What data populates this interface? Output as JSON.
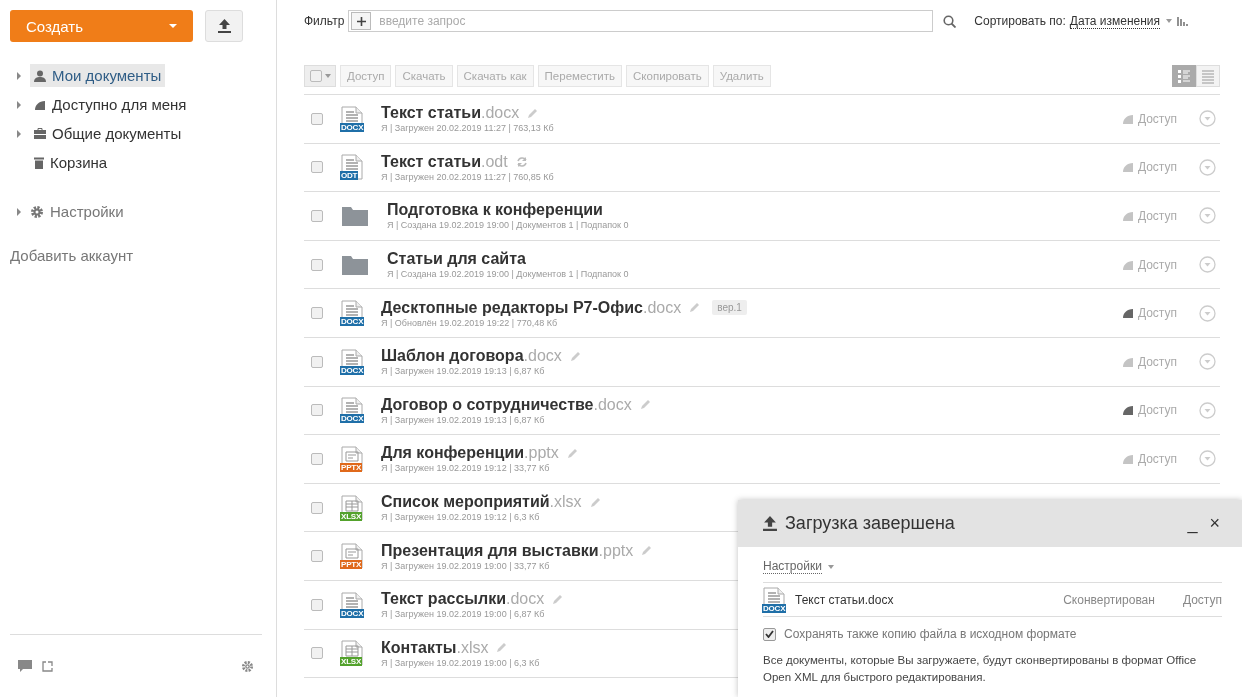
{
  "sidebar": {
    "create_button": "Создать",
    "tree": [
      {
        "label": "Мои документы",
        "kind": "person",
        "expandable": true,
        "selected": true
      },
      {
        "label": "Доступно для меня",
        "kind": "share",
        "expandable": true,
        "selected": false
      },
      {
        "label": "Общие документы",
        "kind": "briefcase",
        "expandable": true,
        "selected": false
      },
      {
        "label": "Корзина",
        "kind": "trash",
        "expandable": false,
        "selected": false
      }
    ],
    "settings": "Настройки",
    "add_account": "Добавить аккаунт"
  },
  "filter": {
    "label": "Фильтр",
    "placeholder": "введите запрос"
  },
  "sort": {
    "label": "Сортировать по:",
    "value": "Дата изменения"
  },
  "toolbar": {
    "select_all": {
      "checked": false
    },
    "buttons": [
      "Доступ",
      "Скачать",
      "Скачать как",
      "Переместить",
      "Скопировать",
      "Удалить"
    ],
    "views": [
      {
        "kind": "detailed",
        "selected": true
      },
      {
        "kind": "compact",
        "selected": false
      }
    ]
  },
  "files": [
    {
      "kind": "docx",
      "badge": "DOCX",
      "name": "Текст статьи",
      "ext": ".docx",
      "checked": false,
      "editable": true,
      "converting": false,
      "meta": "Я | Загружен 20.02.2019 11:27 | 763,13 Кб",
      "share": {
        "label": "Доступ",
        "shared": false
      }
    },
    {
      "kind": "odt",
      "badge": "ODT",
      "name": "Текст статьи",
      "ext": ".odt",
      "checked": false,
      "editable": false,
      "converting": true,
      "meta": "Я | Загружен 20.02.2019 11:27 | 760,85 Кб",
      "share": {
        "label": "Доступ",
        "shared": false
      }
    },
    {
      "kind": "folder",
      "name": "Подготовка к конференции",
      "checked": false,
      "editable": false,
      "converting": false,
      "meta": "Я | Создана 19.02.2019 19:00 | Документов 1 | Подпапок 0",
      "share": {
        "label": "Доступ",
        "shared": false
      }
    },
    {
      "kind": "folder",
      "name": "Статьи для сайта",
      "checked": false,
      "editable": false,
      "converting": false,
      "meta": "Я | Создана 19.02.2019 19:00 | Документов 1 | Подпапок 0",
      "share": {
        "label": "Доступ",
        "shared": false
      }
    },
    {
      "kind": "docx",
      "badge": "DOCX",
      "name": "Десктопные редакторы Р7-Офис",
      "ext": ".docx",
      "checked": false,
      "editable": true,
      "converting": false,
      "version": "вер.1",
      "meta": "Я | Обновлён 19.02.2019 19:22 | 770,48 Кб",
      "share": {
        "label": "Доступ",
        "shared": true
      }
    },
    {
      "kind": "docx",
      "badge": "DOCX",
      "name": "Шаблон договора",
      "ext": ".docx",
      "checked": false,
      "editable": true,
      "converting": false,
      "meta": "Я | Загружен 19.02.2019 19:13 | 6,87 Кб",
      "share": {
        "label": "Доступ",
        "shared": false
      }
    },
    {
      "kind": "docx",
      "badge": "DOCX",
      "name": "Договор о сотрудничестве",
      "ext": ".docx",
      "checked": false,
      "editable": true,
      "converting": false,
      "meta": "Я | Загружен 19.02.2019 19:13 | 6,87 Кб",
      "share": {
        "label": "Доступ",
        "shared": true
      }
    },
    {
      "kind": "pptx",
      "badge": "PPTX",
      "name": "Для конференции",
      "ext": ".pptx",
      "checked": false,
      "editable": true,
      "converting": false,
      "meta": "Я | Загружен 19.02.2019 19:12 | 33,77 Кб",
      "share": {
        "label": "Доступ",
        "shared": false
      }
    },
    {
      "kind": "xlsx",
      "badge": "XLSX",
      "name": "Список мероприятий",
      "ext": ".xlsx",
      "checked": false,
      "editable": true,
      "converting": false,
      "meta": "Я | Загружен 19.02.2019 19:12 | 6,3 Кб"
    },
    {
      "kind": "pptx",
      "badge": "PPTX",
      "name": "Презентация для выставки",
      "ext": ".pptx",
      "checked": false,
      "editable": true,
      "converting": false,
      "meta": "Я | Загружен 19.02.2019 19:00 | 33,77 Кб"
    },
    {
      "kind": "docx",
      "badge": "DOCX",
      "name": "Текст рассылки",
      "ext": ".docx",
      "checked": false,
      "editable": true,
      "converting": false,
      "meta": "Я | Загружен 19.02.2019 19:00 | 6,87 Кб"
    },
    {
      "kind": "xlsx",
      "badge": "XLSX",
      "name": "Контакты",
      "ext": ".xlsx",
      "checked": false,
      "editable": true,
      "converting": false,
      "meta": "Я | Загружен 19.02.2019 19:00 | 6,3 Кб"
    }
  ],
  "upload_panel": {
    "title": "Загрузка завершена",
    "minimize": "_",
    "close": "×",
    "settings": "Настройки",
    "items": [
      {
        "kind": "docx",
        "badge": "DOCX",
        "name": "Текст статьи.docx",
        "status": "Сконвертирован",
        "share": "Доступ"
      }
    ],
    "keep_copy": {
      "label": "Сохранять также копию файла в исходном формате",
      "checked": true
    },
    "note": "Все документы, которые Вы загружаете, будут сконвертированы в формат Office Open XML для быстрого редактирования."
  }
}
